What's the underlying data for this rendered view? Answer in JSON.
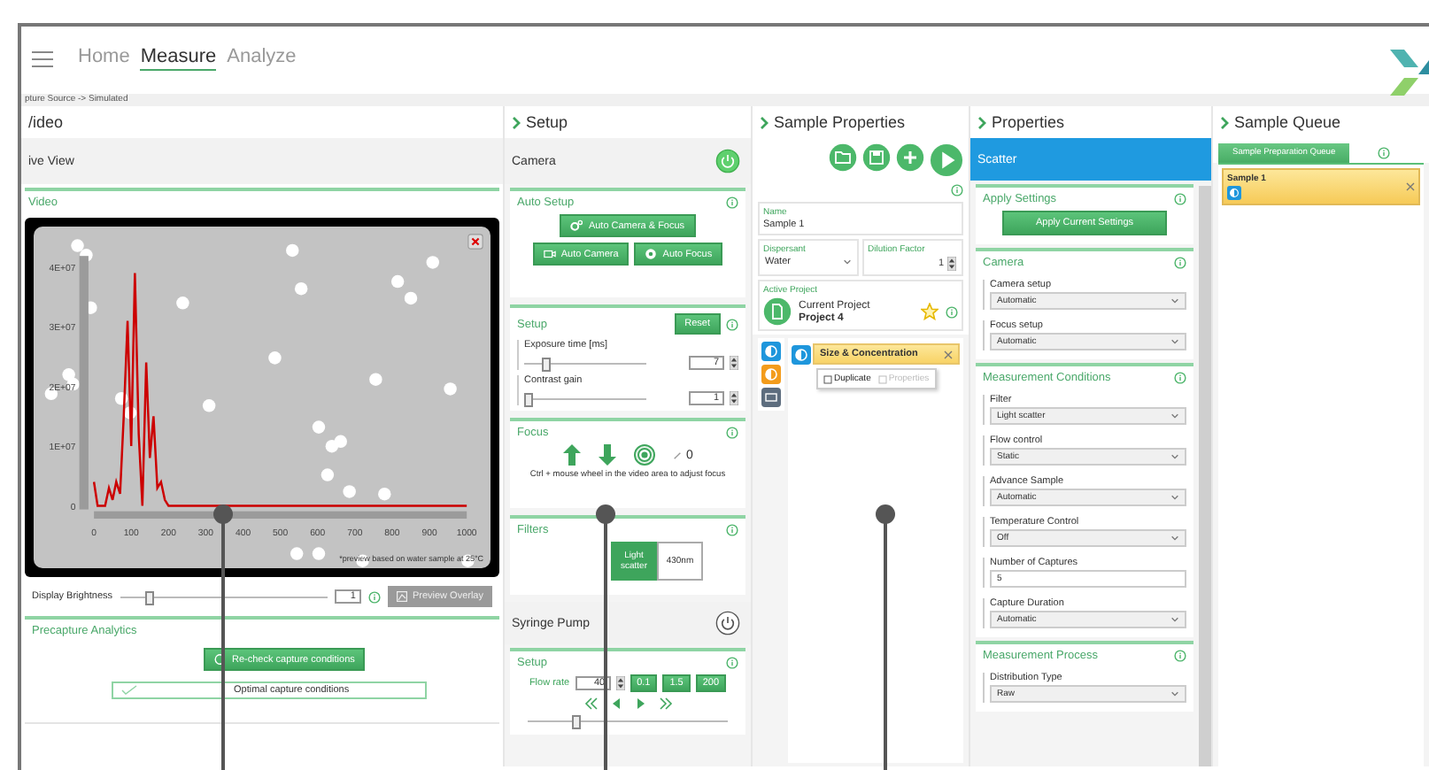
{
  "nav": {
    "items": [
      {
        "label": "Home",
        "selected": false
      },
      {
        "label": "Measure",
        "selected": true
      },
      {
        "label": "Analyze",
        "selected": false
      }
    ]
  },
  "breadcrumb": "pture Source -> Simulated",
  "video": {
    "title": "/ideo",
    "subtitle": "ive View",
    "section": "Video",
    "chart_data": {
      "type": "line",
      "x": [
        0,
        10,
        20,
        30,
        40,
        50,
        60,
        70,
        80,
        90,
        100,
        110,
        120,
        130,
        140,
        150,
        160,
        170,
        180,
        190,
        200,
        250,
        1000
      ],
      "series": [
        {
          "color": "#cc0000",
          "values": [
            4000000,
            0,
            0,
            0,
            3000000,
            1000000,
            4000000,
            2000000,
            15000000,
            31000000,
            10000000,
            39000000,
            12000000,
            0,
            24000000,
            8000000,
            15000000,
            3000000,
            4000000,
            1000000,
            0,
            0,
            0
          ]
        }
      ],
      "xlim": [
        0,
        1000
      ],
      "ylim": [
        0,
        40000000
      ],
      "xticks": [
        0,
        100,
        200,
        300,
        400,
        500,
        600,
        700,
        800,
        900,
        1000
      ],
      "yticks": [
        {
          "value": 0,
          "label": "0"
        },
        {
          "value": 10000000,
          "label": "1E+07"
        },
        {
          "value": 20000000,
          "label": "2E+07"
        },
        {
          "value": 30000000,
          "label": "3E+07"
        },
        {
          "value": 40000000,
          "label": "4E+07"
        }
      ]
    },
    "note": "*preview based on water sample at 25°C",
    "brightness": {
      "label": "Display Brightness",
      "level": 0.12,
      "value": "1"
    },
    "overlay_button": "Preview Overlay",
    "precapture": {
      "title": "Precapture Analytics",
      "button": "Re-check capture conditions",
      "status": "Optimal capture conditions"
    }
  },
  "setup": {
    "title": "Setup",
    "camera": {
      "label": "Camera",
      "on": true
    },
    "auto_setup": {
      "title": "Auto Setup",
      "buttons": [
        {
          "label": "Auto Camera & Focus",
          "kind": "gears"
        },
        {
          "label": "Auto Camera",
          "kind": "camera"
        },
        {
          "label": "Auto Focus",
          "kind": "focus"
        }
      ]
    },
    "camera_setup": {
      "title": "Setup",
      "reset": "Reset",
      "sliders": [
        {
          "label": "Exposure time [ms]",
          "level": 0.15,
          "value": "7"
        },
        {
          "label": "Contrast gain",
          "level": 0.0,
          "value": "1"
        }
      ]
    },
    "focus": {
      "title": "Focus",
      "value": "0",
      "hint": "Ctrl + mouse wheel in the video area to adjust focus"
    },
    "filters": {
      "title": "Filters",
      "options": [
        {
          "label": "Light scatter",
          "selected": true
        },
        {
          "label": "430nm",
          "selected": false
        }
      ]
    },
    "pump": {
      "label": "Syringe Pump",
      "on": false
    },
    "pump_setup": {
      "title": "Setup",
      "flow_label": "Flow rate",
      "flow_value": "40",
      "presets": [
        "0.1",
        "1.5",
        "200"
      ],
      "level": 0.22
    }
  },
  "sample": {
    "title": "Sample Properties",
    "name_label": "Name",
    "name_value": "Sample 1",
    "dispersant_label": "Dispersant",
    "dispersant_value": "Water",
    "dilution_label": "Dilution Factor",
    "dilution_value": "1",
    "project_label": "Active Project",
    "project_caption": "Current Project",
    "project_name": "Project 4",
    "starred": true,
    "method_tabs": [
      {
        "color": "#1e96dc",
        "kind": "drop"
      },
      {
        "color": "#f39c1c",
        "kind": "drop"
      },
      {
        "color": "#5d6d7e",
        "kind": "screen"
      }
    ],
    "method": {
      "label": "Size & Concentration",
      "menu": [
        {
          "label": "Duplicate",
          "disabled": false
        },
        {
          "label": "Properties",
          "disabled": true
        }
      ]
    }
  },
  "properties": {
    "title": "Properties",
    "mode": "Scatter",
    "sections": [
      {
        "title": "Apply Settings",
        "button": "Apply Current Settings"
      },
      {
        "title": "Camera",
        "fields": [
          {
            "label": "Camera setup",
            "value": "Automatic",
            "kind": "select"
          },
          {
            "label": "Focus setup",
            "value": "Automatic",
            "kind": "select"
          }
        ]
      },
      {
        "title": "Measurement Conditions",
        "fields": [
          {
            "label": "Filter",
            "value": "Light scatter",
            "kind": "select"
          },
          {
            "label": "Flow control",
            "value": "Static",
            "kind": "select"
          },
          {
            "label": "Advance Sample",
            "value": "Automatic",
            "kind": "select"
          },
          {
            "label": "Temperature Control",
            "value": "Off",
            "kind": "select"
          },
          {
            "label": "Number of Captures",
            "value": "5",
            "kind": "input"
          },
          {
            "label": "Capture Duration",
            "value": "Automatic",
            "kind": "select"
          }
        ]
      },
      {
        "title": "Measurement Process",
        "fields": [
          {
            "label": "Distribution Type",
            "value": "Raw",
            "kind": "select"
          }
        ]
      }
    ]
  },
  "queue": {
    "title": "Sample Queue",
    "tabs": [
      {
        "label": "Sample Preparation Queue",
        "selected": true
      }
    ],
    "items": [
      {
        "name": "Sample 1"
      }
    ]
  }
}
